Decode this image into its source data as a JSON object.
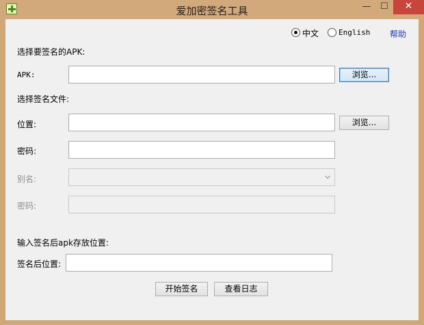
{
  "window": {
    "title": "爱加密签名工具",
    "minimize_glyph": "—",
    "maximize_glyph": "☐",
    "close_glyph": "✕"
  },
  "language": {
    "options": [
      "中文",
      "English"
    ],
    "selected": "中文",
    "help_link": "帮助"
  },
  "apk_section": {
    "heading": "选择要签名的APK:",
    "apk_label": "APK:",
    "apk_value": "",
    "browse_label": "浏览..."
  },
  "sign_file_section": {
    "heading": "选择签名文件:",
    "location_label": "位置:",
    "location_value": "",
    "browse_label": "浏览...",
    "password_label": "密码:",
    "password_value": "",
    "alias_label": "别名:",
    "alias_value": "",
    "alias_password_label": "密码:",
    "alias_password_value": ""
  },
  "output_section": {
    "heading": "输入签名后apk存放位置:",
    "output_label": "签名后位置:",
    "output_value": ""
  },
  "actions": {
    "start_label": "开始签名",
    "log_label": "查看日志"
  }
}
